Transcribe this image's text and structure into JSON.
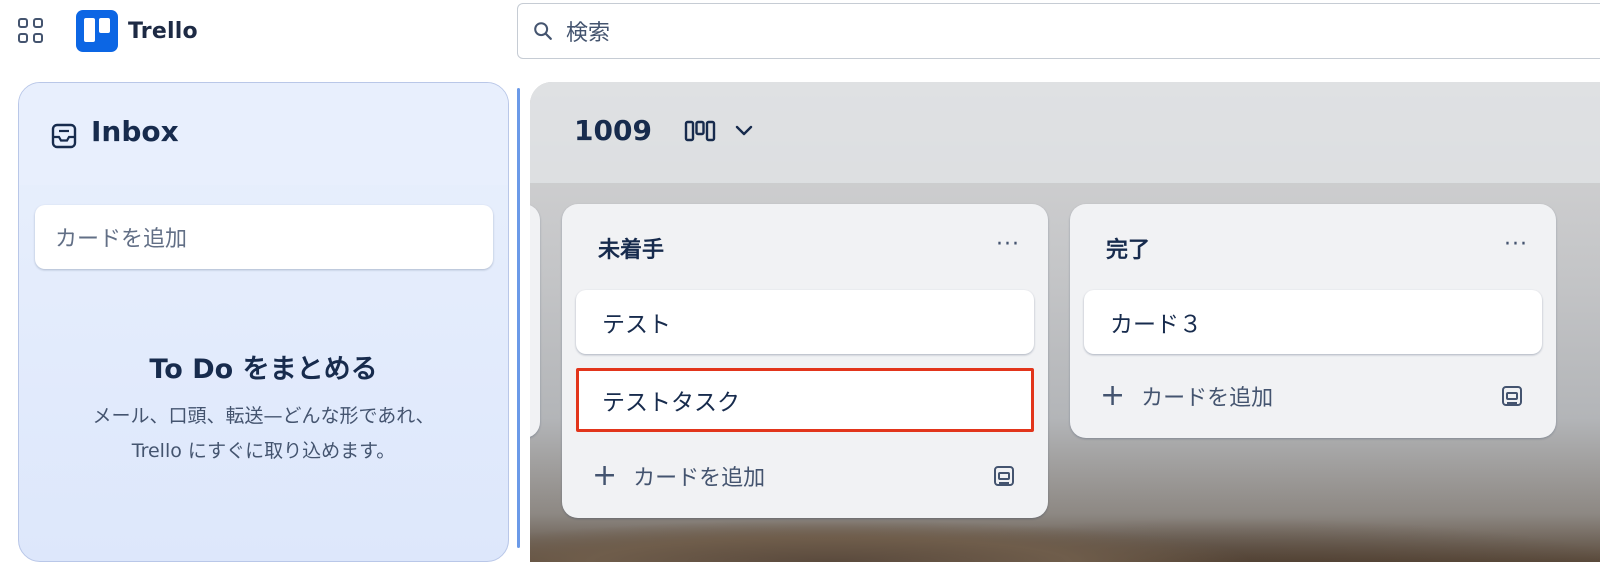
{
  "topbar": {
    "app_name": "Trello",
    "search_placeholder": "検索"
  },
  "inbox": {
    "title": "Inbox",
    "add_card_placeholder": "カードを追加",
    "empty_heading": "To Do をまとめる",
    "empty_desc_line1": "メール、口頭、転送—どんな形であれ、",
    "empty_desc_line2": "Trello にすぐに取り込めます。"
  },
  "board": {
    "title": "1009",
    "lists": [
      {
        "title": "未着手",
        "menu": "···",
        "cards": [
          "テスト",
          "テストタスク"
        ],
        "add_card_label": "カードを追加"
      },
      {
        "title": "完了",
        "menu": "···",
        "cards": [
          "カード３"
        ],
        "add_card_label": "カードを追加"
      }
    ]
  },
  "colors": {
    "brand": "#0c66e4",
    "editing_border": "#e2351b",
    "text": "#172b4d"
  },
  "icons": [
    "apps-grid-icon",
    "trello-logo-icon",
    "search-icon",
    "inbox-icon",
    "board-view-icon",
    "chevron-down-icon",
    "plus-icon",
    "card-template-icon",
    "ellipsis-icon"
  ]
}
